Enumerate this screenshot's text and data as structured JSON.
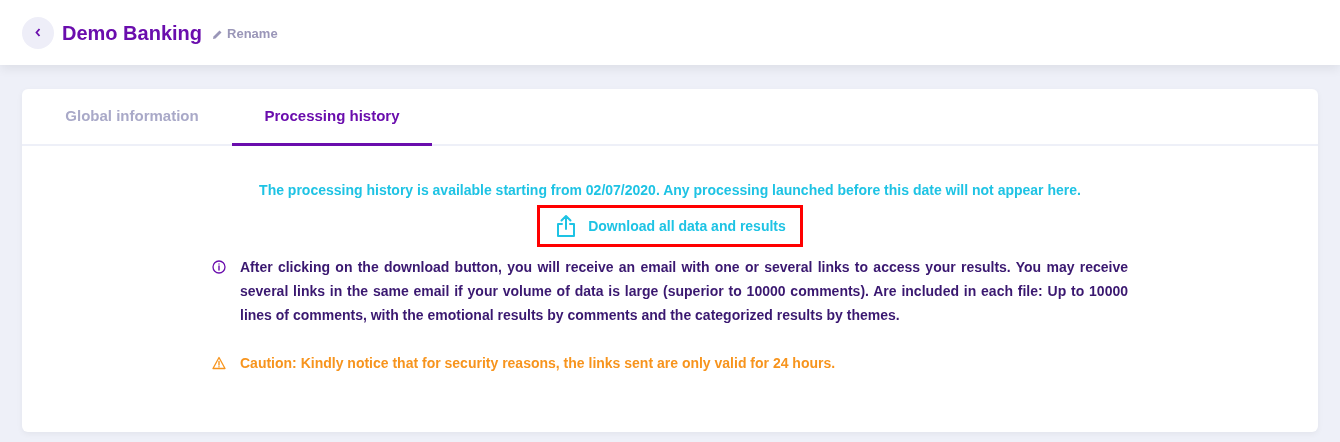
{
  "header": {
    "title": "Demo Banking",
    "rename_label": "Rename"
  },
  "tabs": [
    {
      "label": "Global information",
      "selected": false
    },
    {
      "label": "Processing history",
      "selected": true
    }
  ],
  "availability_notice": "The processing history is available starting from 02/07/2020. Any processing launched before this date will not appear here.",
  "download_button": {
    "label": "Download all data and results",
    "highlighted": true
  },
  "notes": [
    {
      "kind": "info",
      "text": "After clicking on the download button, you will receive an email with one or several links to access your results. You may receive several links in the same email if your volume of data is large (superior to 10000 comments). Are included in each file: Up to 10000 lines of comments, with the emotional results by comments and the categorized results by themes."
    },
    {
      "kind": "warning",
      "text": "Caution: Kindly notice that for security reasons, the links sent are only valid for 24 hours."
    }
  ]
}
